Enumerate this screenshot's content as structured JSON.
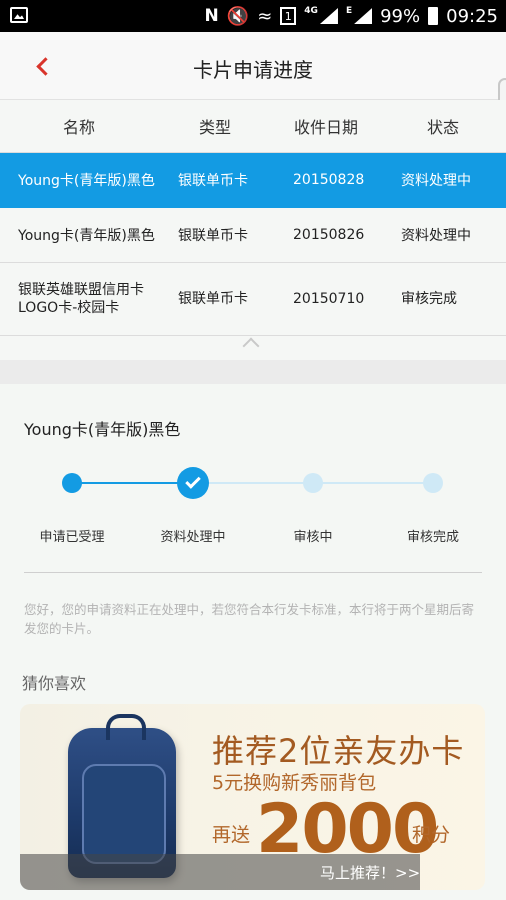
{
  "statusbar": {
    "battery": "99%",
    "time": "09:25",
    "network_label": "4G",
    "signal_letter": "E",
    "n_glyph": "N",
    "sim_digit": "1"
  },
  "header": {
    "title": "卡片申请进度"
  },
  "table": {
    "columns": [
      "名称",
      "类型",
      "收件日期",
      "状态"
    ],
    "rows": [
      {
        "name": "Young卡(青年版)黑色",
        "type": "银联单币卡",
        "date": "20150828",
        "status": "资料处理中",
        "selected": true
      },
      {
        "name": "Young卡(青年版)黑色",
        "type": "银联单币卡",
        "date": "20150826",
        "status": "资料处理中",
        "selected": false
      },
      {
        "name_line1": "银联英雄联盟信用卡",
        "name_line2": "LOGO卡-校园卡",
        "type": "银联单币卡",
        "date": "20150710",
        "status": "审核完成",
        "selected": false
      }
    ]
  },
  "detail": {
    "card_name": "Young卡(青年版)黑色",
    "steps": [
      "申请已受理",
      "资料处理中",
      "审核中",
      "审核完成"
    ],
    "current_step": 2,
    "notice": "您好，您的申请资料正在处理中，若您符合本行发卡标准，本行将于两个星期后寄发您的卡片。",
    "guess_title": "猜你喜欢"
  },
  "banner": {
    "title": "推荐2位亲友办卡",
    "subtitle": "5元换购新秀丽背包",
    "send_prefix": "再送",
    "points_number": "2000",
    "points_suffix": "积分",
    "cta": "马上推荐！>>"
  },
  "colors": {
    "accent_blue": "#139be3",
    "back_red": "#d9342b",
    "step_done": "#139be3",
    "step_pending": "#cfe9f6",
    "banner_orange": "#b0601c"
  }
}
